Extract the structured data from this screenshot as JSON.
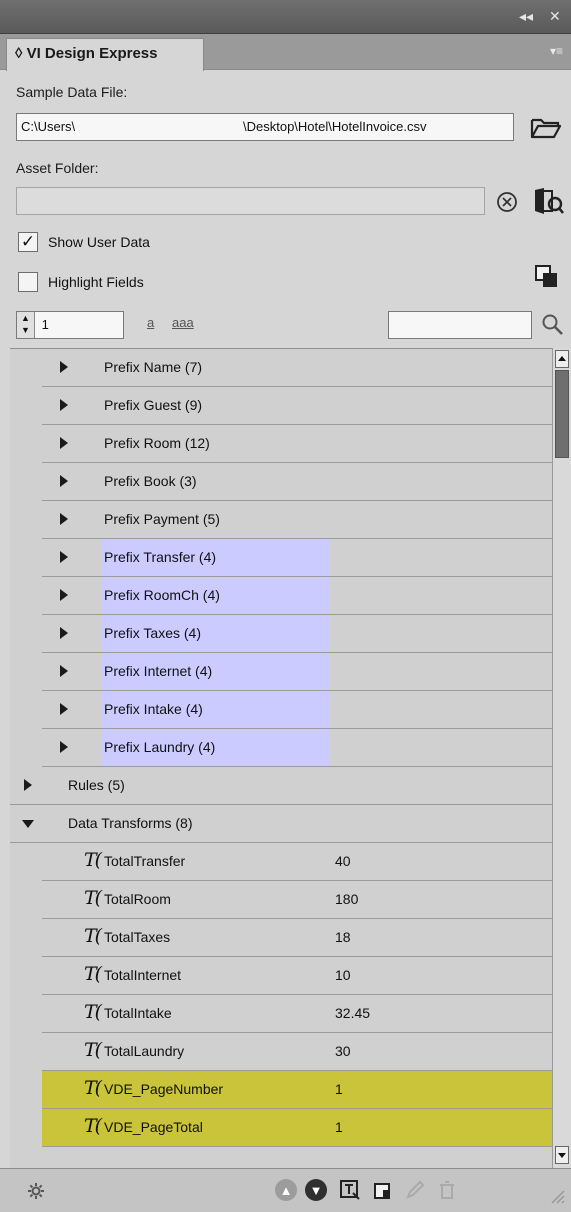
{
  "window": {
    "collapse_glyph": "◂◂",
    "close_glyph": "✕"
  },
  "panel": {
    "tab_title": "◊ VI Design Express",
    "menu_glyph": "▾≡"
  },
  "sample_data": {
    "label": "Sample Data File:",
    "path_left": "C:\\Users\\",
    "path_right": "\\Desktop\\Hotel\\HotelInvoice.csv"
  },
  "asset_folder": {
    "label": "Asset Folder:",
    "value": ""
  },
  "options": {
    "show_user_data": "Show User Data",
    "show_user_data_checked": true,
    "highlight_fields": "Highlight Fields",
    "highlight_fields_checked": false
  },
  "record": {
    "value": "1",
    "link_single": "a",
    "link_multi": "aaa",
    "search_value": ""
  },
  "tree": {
    "prefix_groups": [
      {
        "label": "Prefix Name (7)",
        "highlighted": false
      },
      {
        "label": "Prefix Guest (9)",
        "highlighted": false
      },
      {
        "label": "Prefix Room (12)",
        "highlighted": false
      },
      {
        "label": "Prefix Book (3)",
        "highlighted": false
      },
      {
        "label": "Prefix Payment (5)",
        "highlighted": false
      },
      {
        "label": "Prefix Transfer (4)",
        "highlighted": true
      },
      {
        "label": "Prefix RoomCh (4)",
        "highlighted": true
      },
      {
        "label": "Prefix Taxes (4)",
        "highlighted": true
      },
      {
        "label": "Prefix Internet (4)",
        "highlighted": true
      },
      {
        "label": "Prefix Intake (4)",
        "highlighted": true
      },
      {
        "label": "Prefix Laundry (4)",
        "highlighted": true
      }
    ],
    "rules": "Rules (5)",
    "data_transforms": "Data Transforms (8)",
    "transforms": [
      {
        "name": "TotalTransfer",
        "value": "40",
        "highlighted": false
      },
      {
        "name": "TotalRoom",
        "value": "180",
        "highlighted": false
      },
      {
        "name": "TotalTaxes",
        "value": "18",
        "highlighted": false
      },
      {
        "name": "TotalInternet",
        "value": "10",
        "highlighted": false
      },
      {
        "name": "TotalIntake",
        "value": "32.45",
        "highlighted": false
      },
      {
        "name": "TotalLaundry",
        "value": "30",
        "highlighted": false
      },
      {
        "name": "VDE_PageNumber",
        "value": "1",
        "highlighted": true
      },
      {
        "name": "VDE_PageTotal",
        "value": "1",
        "highlighted": true
      }
    ]
  },
  "colors": {
    "field_highlight": "#cccbff",
    "system_highlight": "#c9c43a"
  },
  "icons": {
    "browse": "folder-open-icon",
    "clear": "clear-circle-icon",
    "asset_browse": "asset-folder-icon",
    "copy": "copy-frames-icon",
    "search": "search-icon",
    "settings": "gear-icon",
    "up": "up-circle-icon",
    "down": "down-circle-icon",
    "text_frame": "text-frame-icon",
    "new": "new-item-icon",
    "edit": "pencil-icon",
    "delete": "trash-icon"
  }
}
